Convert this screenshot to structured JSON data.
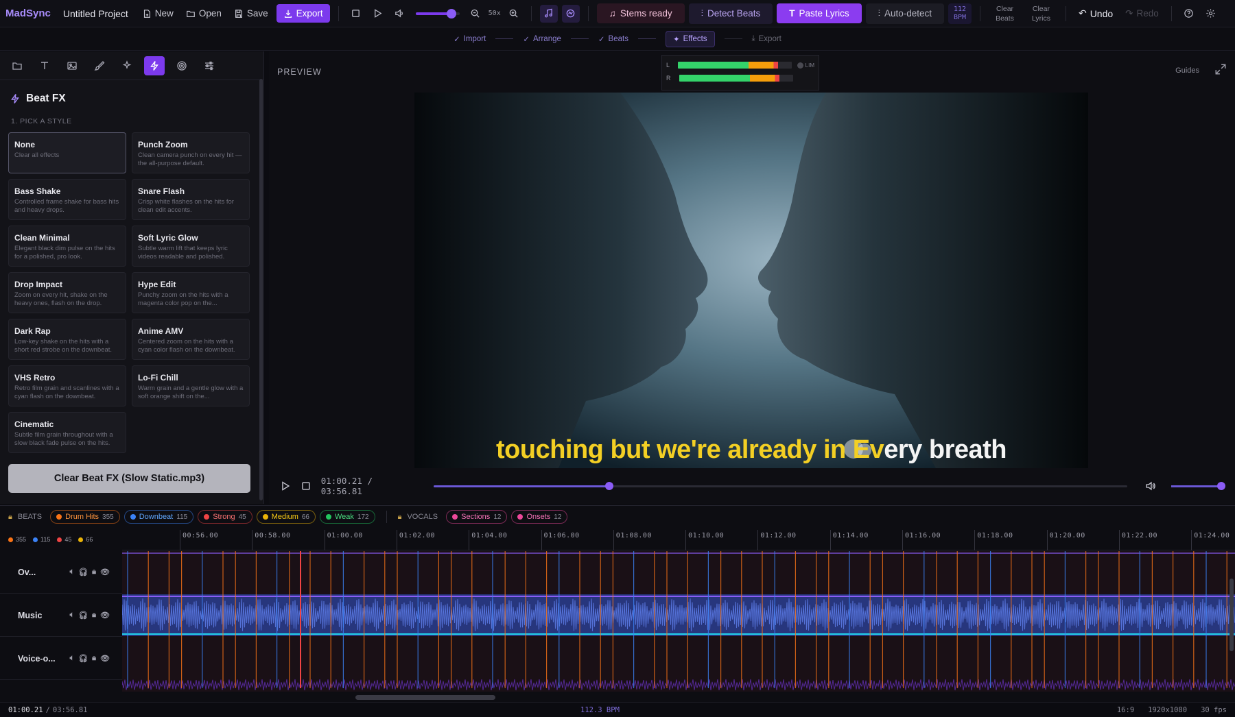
{
  "app": {
    "brand": "MadSync",
    "project": "Untitled Project"
  },
  "toolbar": {
    "new": "New",
    "open": "Open",
    "save": "Save",
    "export": "Export",
    "zoom": "50x",
    "stems": "Stems ready",
    "detect": "Detect Beats",
    "paste": "Paste Lyrics",
    "auto": "Auto-detect",
    "bpm_value": "112",
    "bpm_unit": "BPM",
    "clear_beats_1": "Clear",
    "clear_beats_2": "Beats",
    "clear_lyrics_1": "Clear",
    "clear_lyrics_2": "Lyrics",
    "undo": "Undo",
    "redo": "Redo",
    "volume": 0.82
  },
  "steps": [
    {
      "label": "Import",
      "state": "done"
    },
    {
      "label": "Arrange",
      "state": "done"
    },
    {
      "label": "Beats",
      "state": "done"
    },
    {
      "label": "Effects",
      "state": "active"
    },
    {
      "label": "Export",
      "state": "todo"
    }
  ],
  "panel": {
    "title": "Beat FX",
    "subtitle": "1. PICK A STYLE",
    "styles": [
      {
        "name": "None",
        "desc": "Clear all effects"
      },
      {
        "name": "Punch Zoom",
        "desc": "Clean camera punch on every hit — the all-purpose default."
      },
      {
        "name": "Bass Shake",
        "desc": "Controlled frame shake for bass hits and heavy drops."
      },
      {
        "name": "Snare Flash",
        "desc": "Crisp white flashes on the hits for clean edit accents."
      },
      {
        "name": "Clean Minimal",
        "desc": "Elegant black dim pulse on the hits for a polished, pro look."
      },
      {
        "name": "Soft Lyric Glow",
        "desc": "Subtle warm lift that keeps lyric videos readable and polished."
      },
      {
        "name": "Drop Impact",
        "desc": "Zoom on every hit, shake on the heavy ones, flash on the drop."
      },
      {
        "name": "Hype Edit",
        "desc": "Punchy zoom on the hits with a magenta color pop on the..."
      },
      {
        "name": "Dark Rap",
        "desc": "Low-key shake on the hits with a short red strobe on the downbeat."
      },
      {
        "name": "Anime AMV",
        "desc": "Centered zoom on the hits with a cyan color flash on the downbeat."
      },
      {
        "name": "VHS Retro",
        "desc": "Retro film grain and scanlines with a cyan flash on the downbeat."
      },
      {
        "name": "Lo-Fi Chill",
        "desc": "Warm grain and a gentle glow with a soft orange shift on the..."
      },
      {
        "name": "Cinematic",
        "desc": "Subtle film grain throughout with a slow black fade pulse on the hits."
      }
    ],
    "clear_button": "Clear Beat FX (Slow Static.mp3)"
  },
  "preview": {
    "label": "PREVIEW",
    "guides": "Guides",
    "meter_l": "L",
    "meter_r": "R",
    "meter_lim": "LIM",
    "lyric_highlight": "touching but we're already in Ev",
    "lyric_rest": "ery breath",
    "time_current": "01:00.21",
    "time_total": "03:56.81",
    "progress": 0.254,
    "volume": 0.95
  },
  "beats": {
    "label": "BEATS",
    "chips": [
      {
        "name": "Drum Hits",
        "count": "355",
        "color": "#f97316"
      },
      {
        "name": "Downbeat",
        "count": "115",
        "color": "#3b82f6"
      },
      {
        "name": "Strong",
        "count": "45",
        "color": "#ef4444"
      },
      {
        "name": "Medium",
        "count": "66",
        "color": "#eab308"
      },
      {
        "name": "Weak",
        "count": "172",
        "color": "#22c55e"
      }
    ],
    "vocals_label": "VOCALS",
    "vocal_chips": [
      {
        "name": "Sections",
        "count": "12",
        "color": "#ec4899"
      },
      {
        "name": "Onsets",
        "count": "12",
        "color": "#ec4899"
      }
    ],
    "mini_counts": [
      "355",
      "115",
      "45",
      "66"
    ]
  },
  "ruler": [
    "00:56.00",
    "00:58.00",
    "01:00.00",
    "01:02.00",
    "01:04.00",
    "01:06.00",
    "01:08.00",
    "01:10.00",
    "01:12.00",
    "01:14.00",
    "01:16.00",
    "01:18.00",
    "01:20.00",
    "01:22.00",
    "01:24.00"
  ],
  "tracks": [
    {
      "name": "Ov..."
    },
    {
      "name": "Music"
    },
    {
      "name": "Voice-o..."
    }
  ],
  "status": {
    "current": "01:00.21",
    "total": "03:56.81",
    "bpm": "112.3 BPM",
    "aspect": "16:9",
    "resolution": "1920x1080",
    "fps": "30 fps"
  }
}
